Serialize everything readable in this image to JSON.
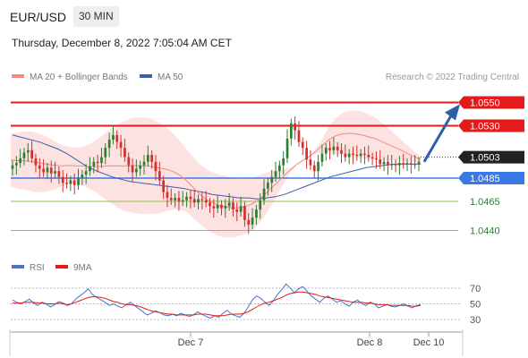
{
  "header": {
    "symbol": "EUR/USD",
    "timeframe": "30 MIN",
    "datetime": "Thursday, December 8, 2022 7:05:04 AM CET",
    "credit": "Research © 2022 Trading Central"
  },
  "legend": {
    "ma20": "MA 20 + Bollinger Bands",
    "ma50": "MA 50",
    "rsi": "RSI",
    "ma9": "9MA"
  },
  "colors": {
    "candle_up": "#2e7d32",
    "candle_down": "#d32f2f",
    "bollinger_fill": "#fde2e2",
    "ma20": "#f28b82",
    "ma50": "#3d5fa8",
    "resistance": "#e31b1b",
    "support": "#8bc34a",
    "pivot": "#3b78e7",
    "arrow": "#2c5fa6",
    "rsi": "#4a73c9",
    "rsi_ma": "#e31b1b"
  },
  "chart_data": [
    {
      "type": "candlestick",
      "x_labels": [
        "Dec 7",
        "Dec 8",
        "Dec 10"
      ],
      "price_range": [
        1.0425,
        1.0565
      ],
      "levels": [
        {
          "value": 1.055,
          "label": "1.0550",
          "kind": "resistance"
        },
        {
          "value": 1.053,
          "label": "1.0530",
          "kind": "resistance"
        },
        {
          "value": 1.0503,
          "label": "1.0503",
          "kind": "current"
        },
        {
          "value": 1.0485,
          "label": "1.0485",
          "kind": "pivot"
        },
        {
          "value": 1.0465,
          "label": "1.0465",
          "kind": "support"
        },
        {
          "value": 1.044,
          "label": "1.0440",
          "kind": "support"
        }
      ],
      "closes": [
        1.0496,
        1.0498,
        1.0502,
        1.0507,
        1.0509,
        1.0502,
        1.0496,
        1.0493,
        1.049,
        1.0494,
        1.0489,
        1.0491,
        1.0486,
        1.0481,
        1.048,
        1.0483,
        1.0479,
        1.0485,
        1.0488,
        1.0491,
        1.0495,
        1.0499,
        1.0498,
        1.0503,
        1.0511,
        1.0518,
        1.0522,
        1.0516,
        1.0511,
        1.0503,
        1.0496,
        1.049,
        1.0493,
        1.0496,
        1.0499,
        1.0505,
        1.0499,
        1.0491,
        1.0483,
        1.0473,
        1.0468,
        1.0466,
        1.0468,
        1.0465,
        1.0466,
        1.0469,
        1.0467,
        1.0464,
        1.0467,
        1.0466,
        1.0464,
        1.0461,
        1.0459,
        1.0462,
        1.0459,
        1.0461,
        1.0464,
        1.0458,
        1.0456,
        1.0461,
        1.0449,
        1.0445,
        1.0451,
        1.0458,
        1.0466,
        1.0476,
        1.0481,
        1.0486,
        1.0491,
        1.0496,
        1.0502,
        1.0519,
        1.0532,
        1.0526,
        1.0516,
        1.0511,
        1.0501,
        1.0496,
        1.0491,
        1.0499,
        1.0506,
        1.0511,
        1.0509,
        1.0512,
        1.0509,
        1.0506,
        1.0503,
        1.0506,
        1.0505,
        1.0504,
        1.0506,
        1.0505,
        1.0503,
        1.0502,
        1.0501,
        1.0497,
        1.0499,
        1.0496,
        1.0497,
        1.0496,
        1.0498,
        1.0497,
        1.0498,
        1.0497,
        1.0497,
        1.0499
      ],
      "bollinger_upper": [
        1.0523,
        1.0524,
        1.0525,
        1.0525,
        1.0524,
        1.0522,
        1.0519,
        1.0516,
        1.0513,
        1.0512,
        1.0511,
        1.0512,
        1.0514,
        1.0517,
        1.0521,
        1.0526,
        1.053,
        1.0533,
        1.0535,
        1.0537,
        1.0537,
        1.0537,
        1.0535,
        1.0532,
        1.0528,
        1.0523,
        1.0517,
        1.051,
        1.0503,
        1.0497,
        1.0493,
        1.049,
        1.0488,
        1.0487,
        1.0485,
        1.0484,
        1.0484,
        1.0485,
        1.0487,
        1.0489,
        1.0491,
        1.0492,
        1.0493,
        1.0494,
        1.0497,
        1.05,
        1.0504,
        1.0511,
        1.052,
        1.053,
        1.0537,
        1.0541,
        1.0543,
        1.0543,
        1.0542,
        1.054,
        1.0537,
        1.0533,
        1.0528,
        1.0523,
        1.0518,
        1.0513,
        1.0508,
        1.0504
      ],
      "bollinger_lower": [
        1.0478,
        1.0476,
        1.0475,
        1.0474,
        1.0473,
        1.0473,
        1.0474,
        1.0476,
        1.0478,
        1.048,
        1.048,
        1.0479,
        1.0476,
        1.0473,
        1.0469,
        1.0465,
        1.0461,
        1.0458,
        1.0456,
        1.0455,
        1.0454,
        1.0454,
        1.0454,
        1.0455,
        1.0457,
        1.0458,
        1.0458,
        1.0456,
        1.0451,
        1.0446,
        1.0441,
        1.0438,
        1.0435,
        1.0434,
        1.0434,
        1.0435,
        1.0437,
        1.044,
        1.0445,
        1.0452,
        1.0461,
        1.0471,
        1.0481,
        1.049,
        1.0497,
        1.0501,
        1.0504,
        1.0506,
        1.0507,
        1.0507,
        1.0506,
        1.0505,
        1.0504,
        1.0503,
        1.0502,
        1.0501,
        1.0501,
        1.05,
        1.05,
        1.05,
        1.05,
        1.0499,
        1.0499,
        1.0499
      ],
      "ma50": [
        1.0522,
        1.052,
        1.0518,
        1.0516,
        1.0513,
        1.051,
        1.0506,
        1.0501,
        1.0496,
        1.0492,
        1.0489,
        1.0486,
        1.0484,
        1.0482,
        1.0481,
        1.048,
        1.0479,
        1.0478,
        1.0477,
        1.0476,
        1.0474,
        1.0473,
        1.0471,
        1.047,
        1.0469,
        1.0468,
        1.0468,
        1.0467,
        1.0468,
        1.0469,
        1.0471,
        1.0474,
        1.0477,
        1.048,
        1.0483,
        1.0486,
        1.0488,
        1.049,
        1.0492,
        1.0494,
        1.0495,
        1.0496,
        1.0497,
        1.0497,
        1.0497,
        1.0497
      ],
      "forecast_target": 1.055
    },
    {
      "type": "line",
      "name": "RSI",
      "y_ticks": [
        70,
        50,
        30
      ],
      "ylim": [
        20,
        80
      ],
      "rsi": [
        55,
        52,
        50,
        53,
        56,
        51,
        48,
        52,
        50,
        46,
        49,
        53,
        51,
        48,
        50,
        56,
        60,
        64,
        69,
        62,
        58,
        55,
        52,
        48,
        50,
        47,
        45,
        49,
        52,
        48,
        44,
        40,
        36,
        38,
        41,
        39,
        36,
        35,
        37,
        35,
        38,
        36,
        34,
        36,
        40,
        37,
        34,
        32,
        35,
        33,
        38,
        42,
        37,
        35,
        33,
        38,
        46,
        55,
        60,
        57,
        52,
        48,
        54,
        62,
        68,
        75,
        70,
        64,
        69,
        72,
        66,
        60,
        56,
        52,
        57,
        60,
        56,
        52,
        54,
        50,
        47,
        52,
        55,
        50,
        48,
        52,
        50,
        45,
        47,
        49,
        47,
        46,
        48,
        50,
        47,
        45,
        48,
        49
      ],
      "rsi_ma": [
        51,
        51,
        51,
        52,
        52,
        52,
        51,
        51,
        50,
        50,
        50,
        51,
        50,
        49,
        50,
        52,
        54,
        56,
        58,
        59,
        59,
        58,
        57,
        55,
        53,
        52,
        50,
        49,
        49,
        48,
        47,
        45,
        43,
        41,
        40,
        39,
        38,
        37,
        37,
        36,
        36,
        36,
        36,
        36,
        37,
        37,
        37,
        36,
        35,
        35,
        35,
        36,
        37,
        37,
        37,
        38,
        40,
        43,
        46,
        49,
        51,
        52,
        54,
        56,
        58,
        61,
        63,
        64,
        65,
        65,
        64,
        63,
        62,
        60,
        59,
        58,
        57,
        56,
        55,
        54,
        53,
        52,
        52,
        52,
        51,
        51,
        50,
        49,
        49,
        49,
        48,
        48,
        48,
        48,
        48,
        47,
        47,
        48
      ]
    }
  ]
}
